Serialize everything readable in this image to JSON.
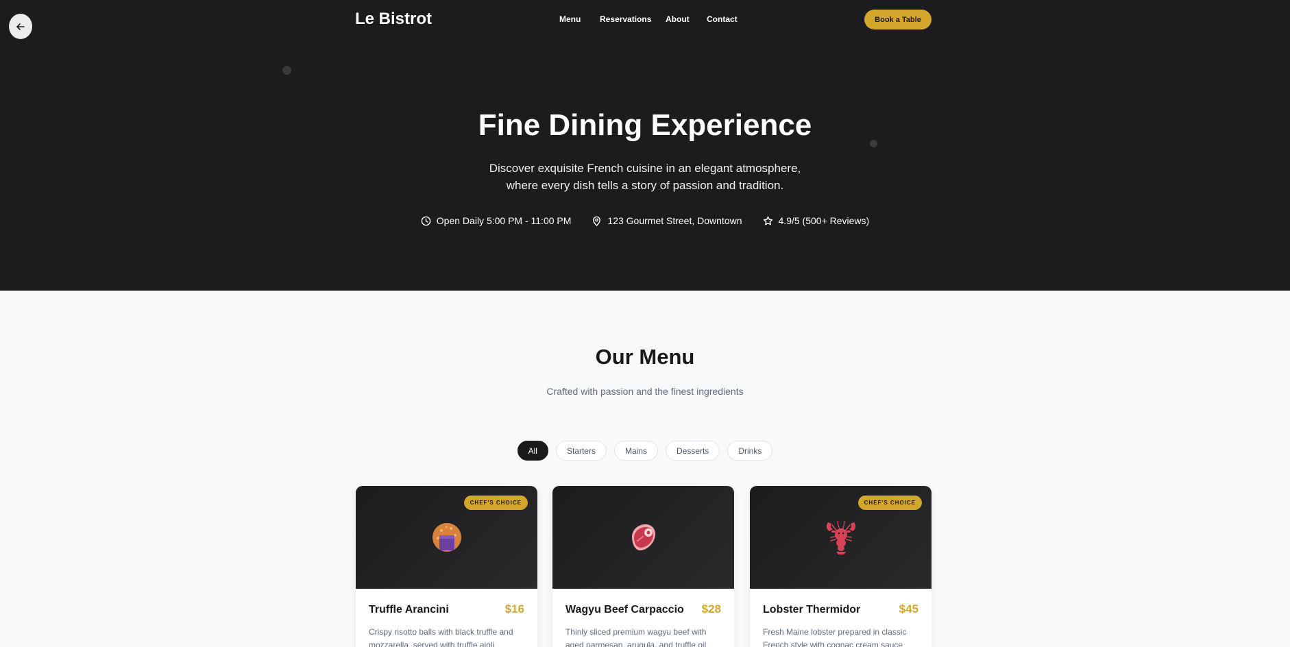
{
  "header": {
    "logo": "Le Bistrot",
    "nav": [
      "Menu",
      "Reservations",
      "About",
      "Contact"
    ],
    "cta": "Book a Table"
  },
  "hero": {
    "title": "Fine Dining Experience",
    "subtitle_line1": "Discover exquisite French cuisine in an elegant atmosphere,",
    "subtitle_line2": "where every dish tells a story of passion and tradition.",
    "hours": "Open Daily 5:00 PM - 11:00 PM",
    "address": "123 Gourmet Street, Downtown",
    "rating": "4.9/5 (500+ Reviews)"
  },
  "menu": {
    "title": "Our Menu",
    "subtitle": "Crafted with passion and the finest ingredients",
    "filters": [
      "All",
      "Starters",
      "Mains",
      "Desserts",
      "Drinks"
    ],
    "active_filter": "All",
    "items": [
      {
        "name": "Truffle Arancini",
        "price": "$16",
        "desc": "Crispy risotto balls with black truffle and mozzarella, served with truffle aioli",
        "badge": "CHEF'S CHOICE",
        "icon": "arancini-icon"
      },
      {
        "name": "Wagyu Beef Carpaccio",
        "price": "$28",
        "desc": "Thinly sliced premium wagyu beef with aged parmesan, arugula, and truffle oil",
        "badge": "",
        "icon": "steak-icon"
      },
      {
        "name": "Lobster Thermidor",
        "price": "$45",
        "desc": "Fresh Maine lobster prepared in classic French style with cognac cream sauce",
        "badge": "CHEF'S CHOICE",
        "icon": "lobster-icon"
      }
    ]
  },
  "colors": {
    "accent": "#d4a72c",
    "dark": "#1c1c1e",
    "light_bg": "#f8f9fb"
  }
}
